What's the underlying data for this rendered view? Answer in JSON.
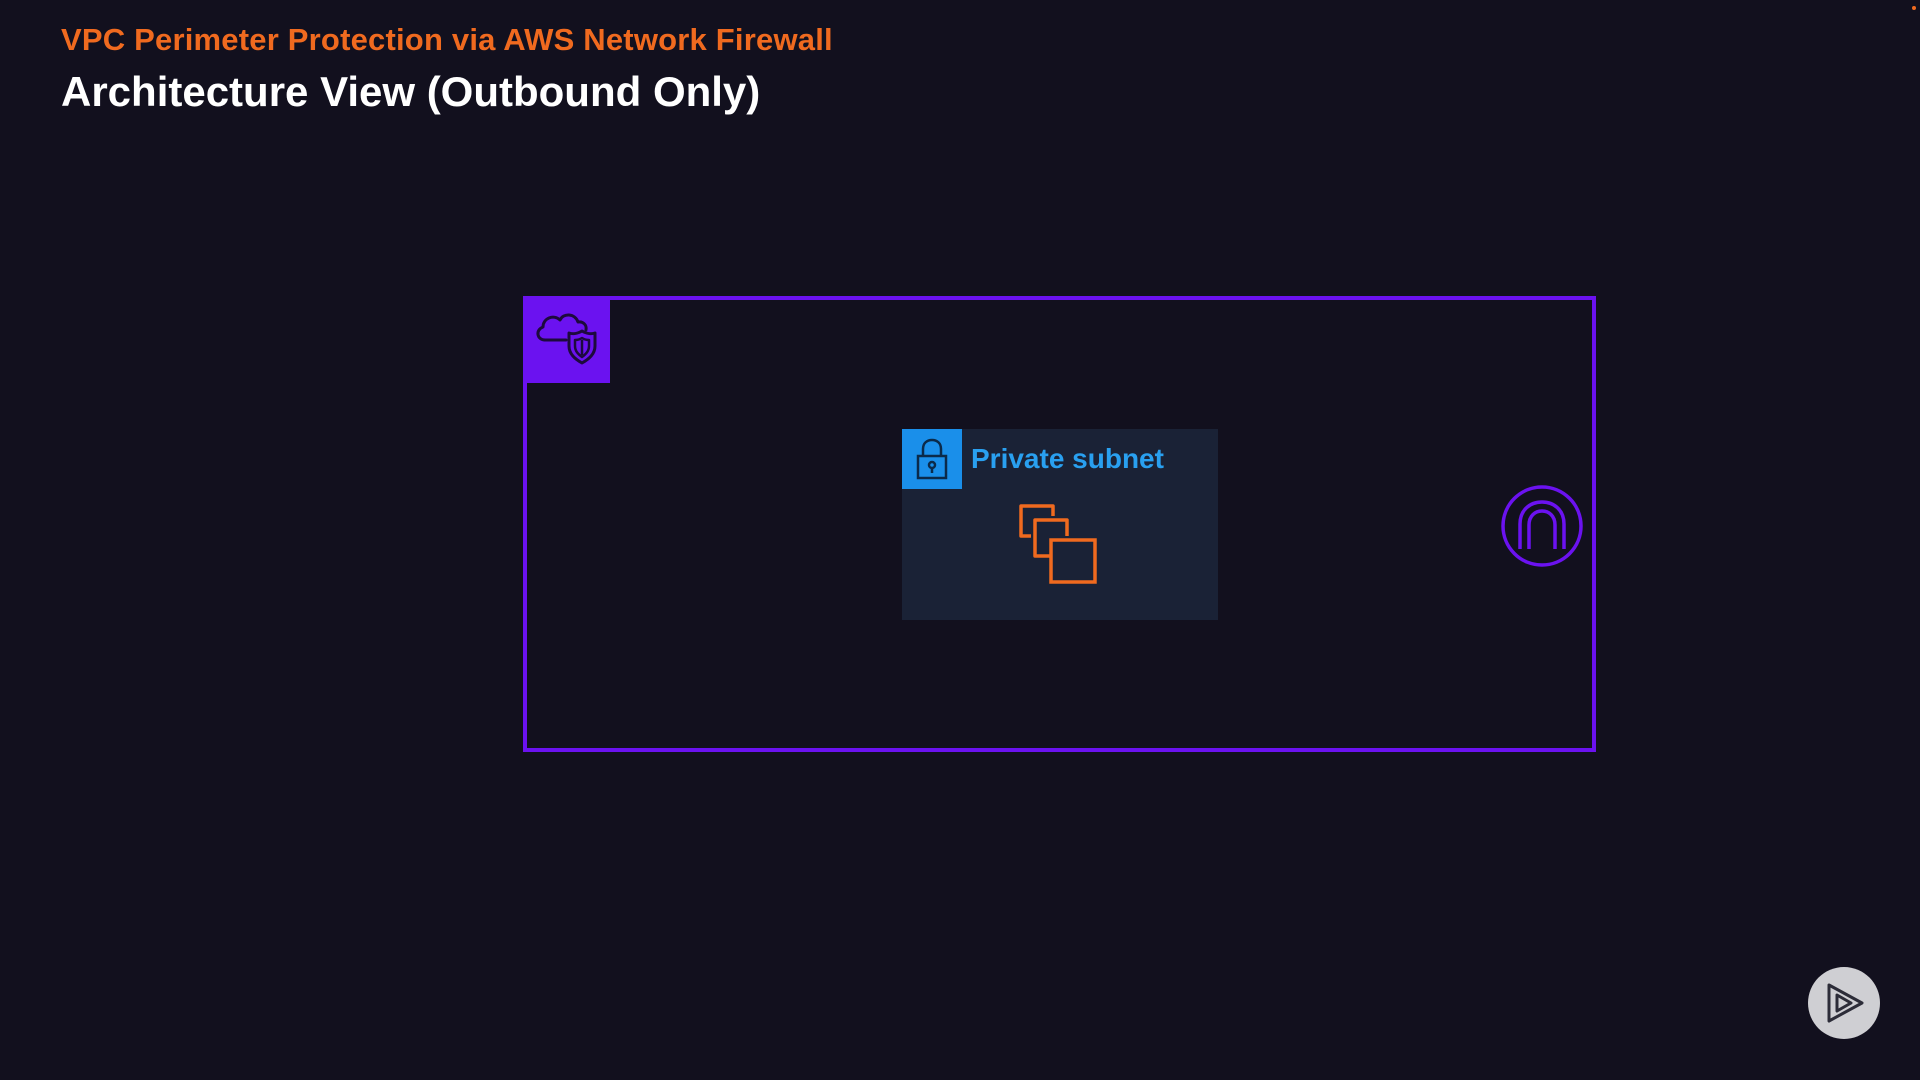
{
  "header": {
    "subtitle": "VPC Perimeter Protection via AWS Network Firewall",
    "title": "Architecture View (Outbound Only)"
  },
  "diagram": {
    "vpc": {
      "badge_icon": "vpc-cloud-shield-icon",
      "border_color": "#6b12f0"
    },
    "private_subnet": {
      "label": "Private subnet",
      "lock_icon": "lock-icon",
      "instances_icon": "ec2-instances-icon",
      "label_color": "#29a0f0",
      "badge_color": "#1a8fea"
    },
    "gateway": {
      "icon": "internet-gateway-icon",
      "color": "#6b12f0"
    }
  },
  "player": {
    "play_icon": "play-icon"
  },
  "colors": {
    "background": "#12101e",
    "accent": "#f06a1f",
    "instances": "#f06a1f"
  }
}
